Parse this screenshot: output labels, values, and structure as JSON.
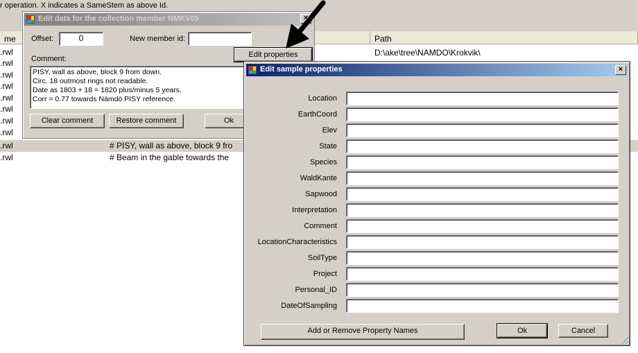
{
  "background": {
    "hint": "r operation. X indicates a SameStem as above Id.",
    "columns": {
      "name": "me",
      "path": "Path"
    },
    "path_value": "D:\\ake\\tree\\NAMDO\\Krokvik\\",
    "rows": [
      {
        "name": ".rwl",
        "comment": ""
      },
      {
        "name": ".rwl",
        "comment": ""
      },
      {
        "name": ".rwl",
        "comment": ""
      },
      {
        "name": ".rwl",
        "comment": ""
      },
      {
        "name": ".rwl",
        "comment": ""
      },
      {
        "name": ".rwl",
        "comment": ""
      },
      {
        "name": ".rwl",
        "comment": ""
      },
      {
        "name": ".rwl",
        "comment": ""
      },
      {
        "name": ".rwl",
        "comment": "# PISY, wall as above, block 9 fro"
      },
      {
        "name": ".rwl",
        "comment": "# Beam in the gable towards the"
      }
    ]
  },
  "edit_dialog": {
    "title": "Edit data for the collection member NMKV05",
    "offset_label": "Offset:",
    "offset_value": "0",
    "new_member_label": "New member id:",
    "new_member_value": "",
    "comment_label": "Comment:",
    "edit_properties_button": "Edit properties",
    "comment_lines": [
      "PISY, wall as above, block 9 from down.",
      "Circ. 18 outmost rings not readable.",
      "Date as 1803 + 18 = 1820 plus/minus 5 years.",
      "Corr = 0.77 towards Nämdö PISY reference."
    ],
    "clear_comment_button": "Clear comment",
    "restore_comment_button": "Restore comment",
    "ok_button": "Ok",
    "close_glyph": "×"
  },
  "props_dialog": {
    "title": "Edit sample properties",
    "close_glyph": "×",
    "properties": [
      {
        "label": "Location",
        "value": ""
      },
      {
        "label": "EarthCoord",
        "value": ""
      },
      {
        "label": "Elev",
        "value": ""
      },
      {
        "label": "State",
        "value": ""
      },
      {
        "label": "Species",
        "value": ""
      },
      {
        "label": "WaldKante",
        "value": ""
      },
      {
        "label": "Sapwood",
        "value": ""
      },
      {
        "label": "Interpretation",
        "value": ""
      },
      {
        "label": "Comment",
        "value": ""
      },
      {
        "label": "LocationCharacteristics",
        "value": ""
      },
      {
        "label": "SoilType",
        "value": ""
      },
      {
        "label": "Project",
        "value": ""
      },
      {
        "label": "Personal_ID",
        "value": ""
      },
      {
        "label": "DateOfSampling",
        "value": ""
      }
    ],
    "add_remove_button": "Add or Remove Property Names",
    "ok_button": "Ok",
    "cancel_button": "Cancel"
  },
  "icons": {
    "app": "app-icon",
    "arrow": "pointer-arrow-icon",
    "grip": "resize-grip-icon"
  },
  "colors": {
    "active_title_start": "#0a246a",
    "active_title_end": "#a6caf0",
    "inactive_title_start": "#808080",
    "face": "#d4d0c8"
  }
}
